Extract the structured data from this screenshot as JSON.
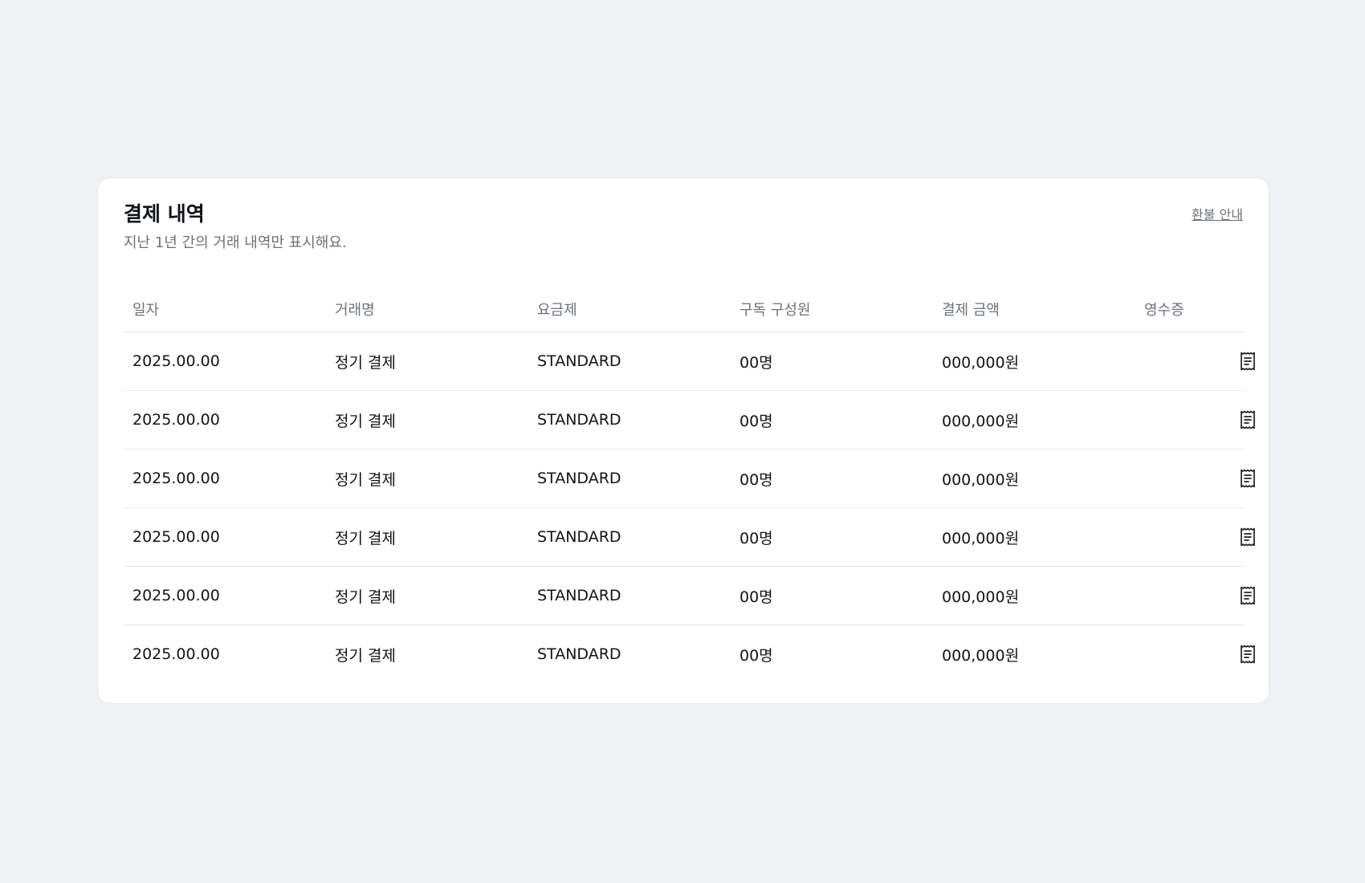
{
  "card": {
    "title": "결제 내역",
    "subtitle": "지난 1년 간의 거래 내역만 표시해요.",
    "refund_link": "환불 안내"
  },
  "table": {
    "headers": [
      "일자",
      "거래명",
      "요금제",
      "구독 구성원",
      "결제 금액",
      "영수증"
    ],
    "rows": [
      {
        "date": "2025.00.00",
        "name": "정기 결제",
        "plan": "STANDARD",
        "members": "00명",
        "amount": "000,000원",
        "receipt_icon": "receipt-icon"
      },
      {
        "date": "2025.00.00",
        "name": "정기 결제",
        "plan": "STANDARD",
        "members": "00명",
        "amount": "000,000원",
        "receipt_icon": "receipt-icon"
      },
      {
        "date": "2025.00.00",
        "name": "정기 결제",
        "plan": "STANDARD",
        "members": "00명",
        "amount": "000,000원",
        "receipt_icon": "receipt-icon"
      },
      {
        "date": "2025.00.00",
        "name": "정기 결제",
        "plan": "STANDARD",
        "members": "00명",
        "amount": "000,000원",
        "receipt_icon": "receipt-icon"
      },
      {
        "date": "2025.00.00",
        "name": "정기 결제",
        "plan": "STANDARD",
        "members": "00명",
        "amount": "000,000원",
        "receipt_icon": "receipt-icon"
      },
      {
        "date": "2025.00.00",
        "name": "정기 결제",
        "plan": "STANDARD",
        "members": "00명",
        "amount": "000,000원",
        "receipt_icon": "receipt-icon"
      }
    ]
  },
  "colors": {
    "page_background": "#eef2f5",
    "card_background": "#ffffff",
    "text_primary": "#111418",
    "text_secondary": "#6b7178",
    "divider": "#e4e8ec"
  }
}
